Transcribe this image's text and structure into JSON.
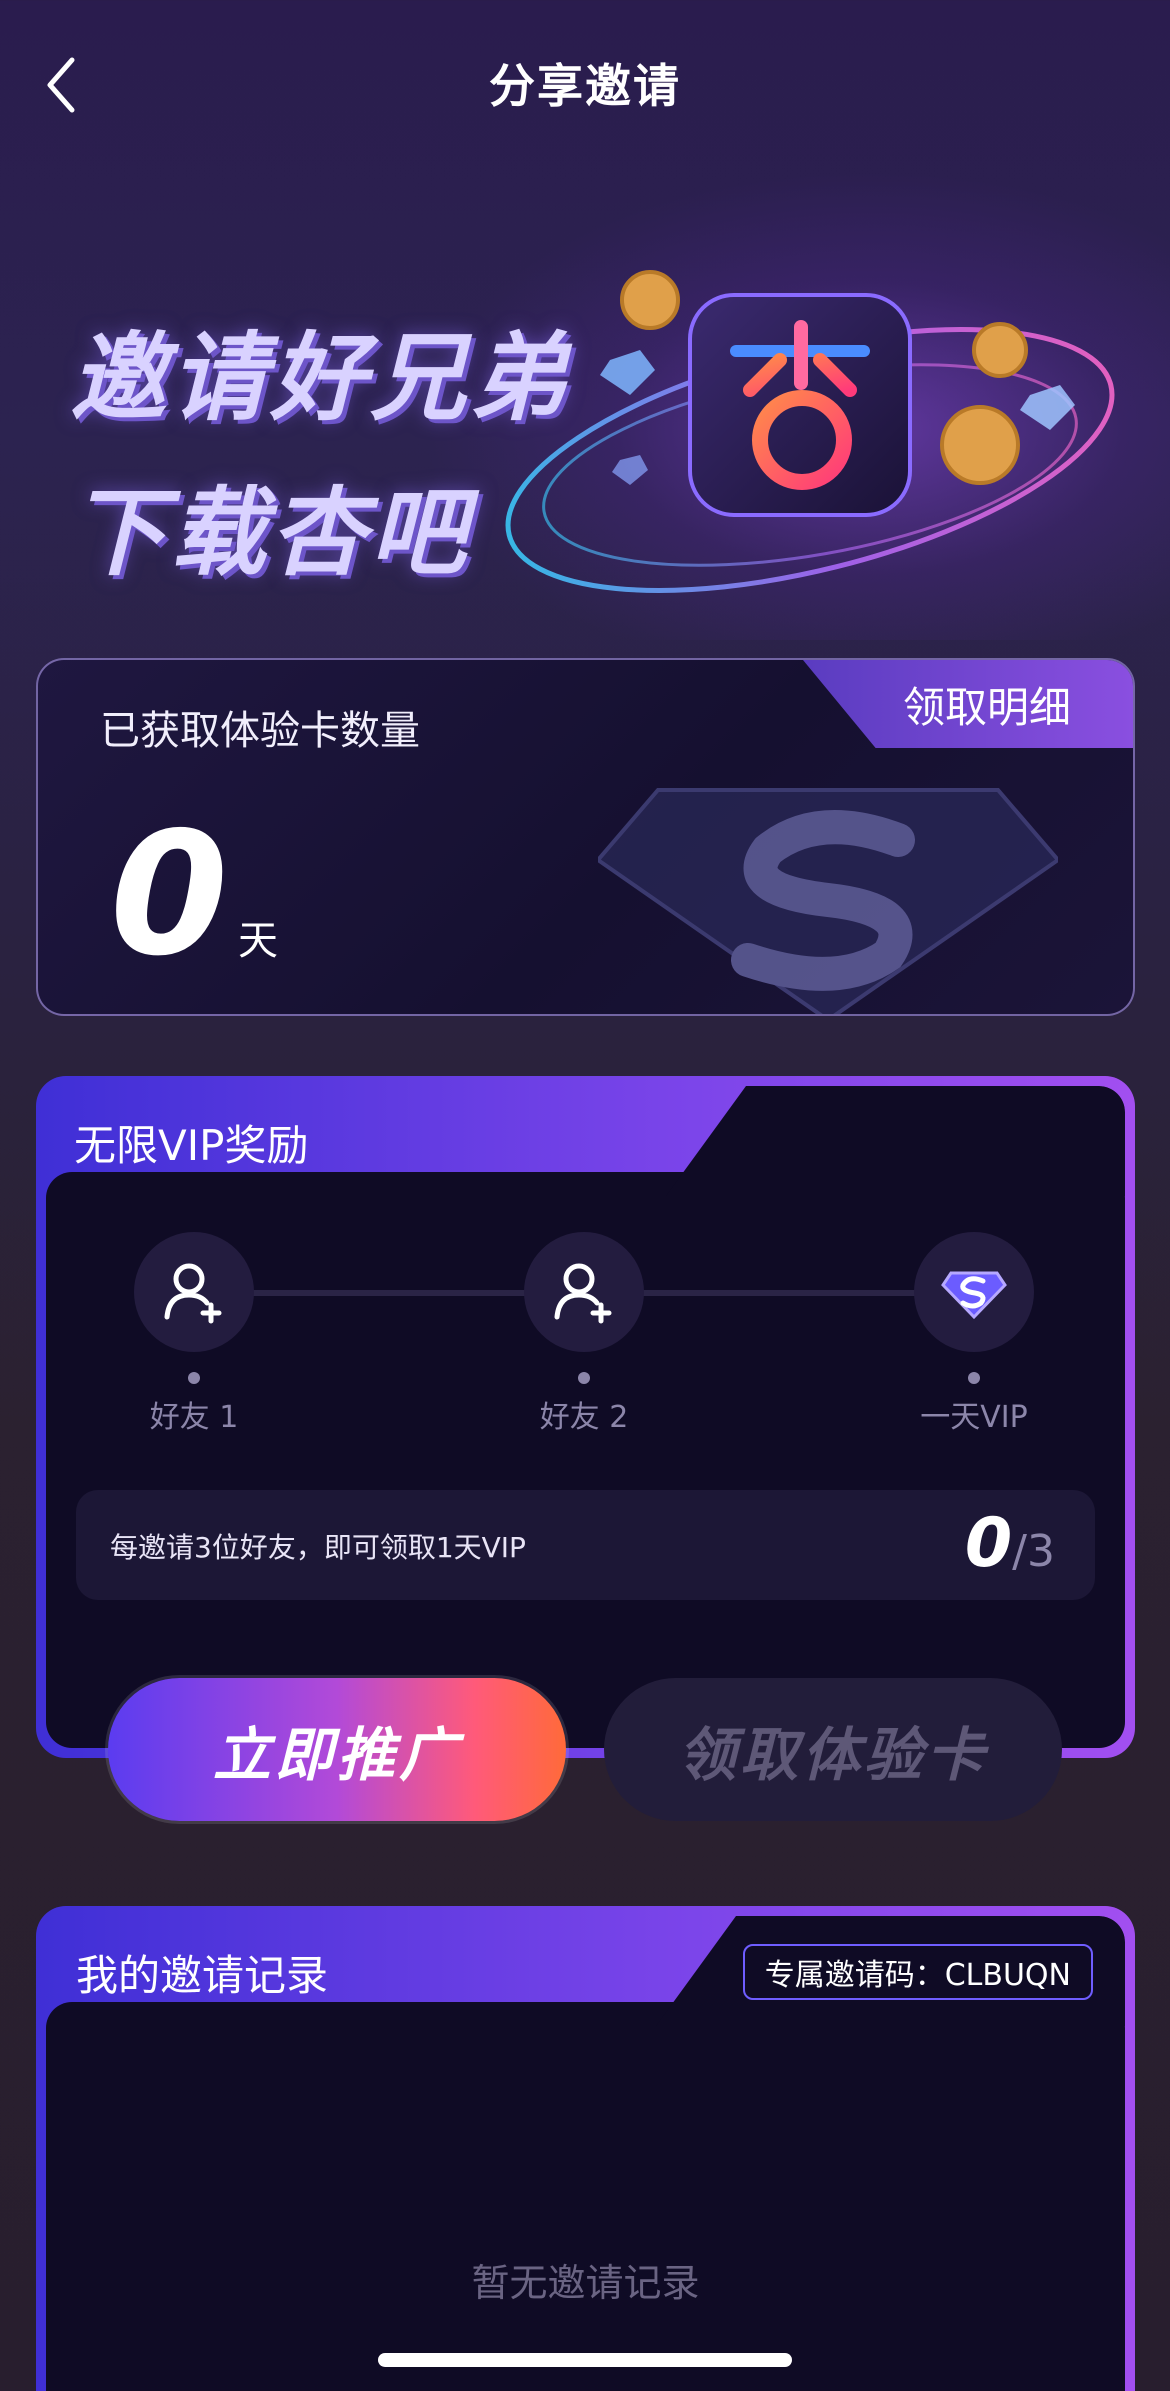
{
  "header": {
    "title": "分享邀请"
  },
  "hero": {
    "line1": "邀请好兄弟",
    "line2": "下载杏吧"
  },
  "count_card": {
    "label": "已获取体验卡数量",
    "detail_tab": "领取明细",
    "value": "0",
    "unit": "天"
  },
  "vip_card": {
    "title": "无限VIP奖励",
    "steps": [
      {
        "label": "好友 1",
        "icon": "add-user-icon"
      },
      {
        "label": "好友 2",
        "icon": "add-user-icon"
      },
      {
        "label": "一天VIP",
        "icon": "diamond-s-icon"
      }
    ],
    "info_text": "每邀请3位好友，即可领取1天VIP",
    "progress_current": "0",
    "progress_total": "/3"
  },
  "buttons": {
    "promote": "立即推广",
    "claim": "领取体验卡"
  },
  "records_card": {
    "title": "我的邀请记录",
    "invite_code": "专属邀请码：CLBUQN",
    "empty": "暂无邀请记录"
  },
  "colors": {
    "accent_start": "#3f2fd6",
    "accent_end": "#a24ff0",
    "promote_end": "#ff6a3a",
    "card_bg": "#0f0b25"
  }
}
